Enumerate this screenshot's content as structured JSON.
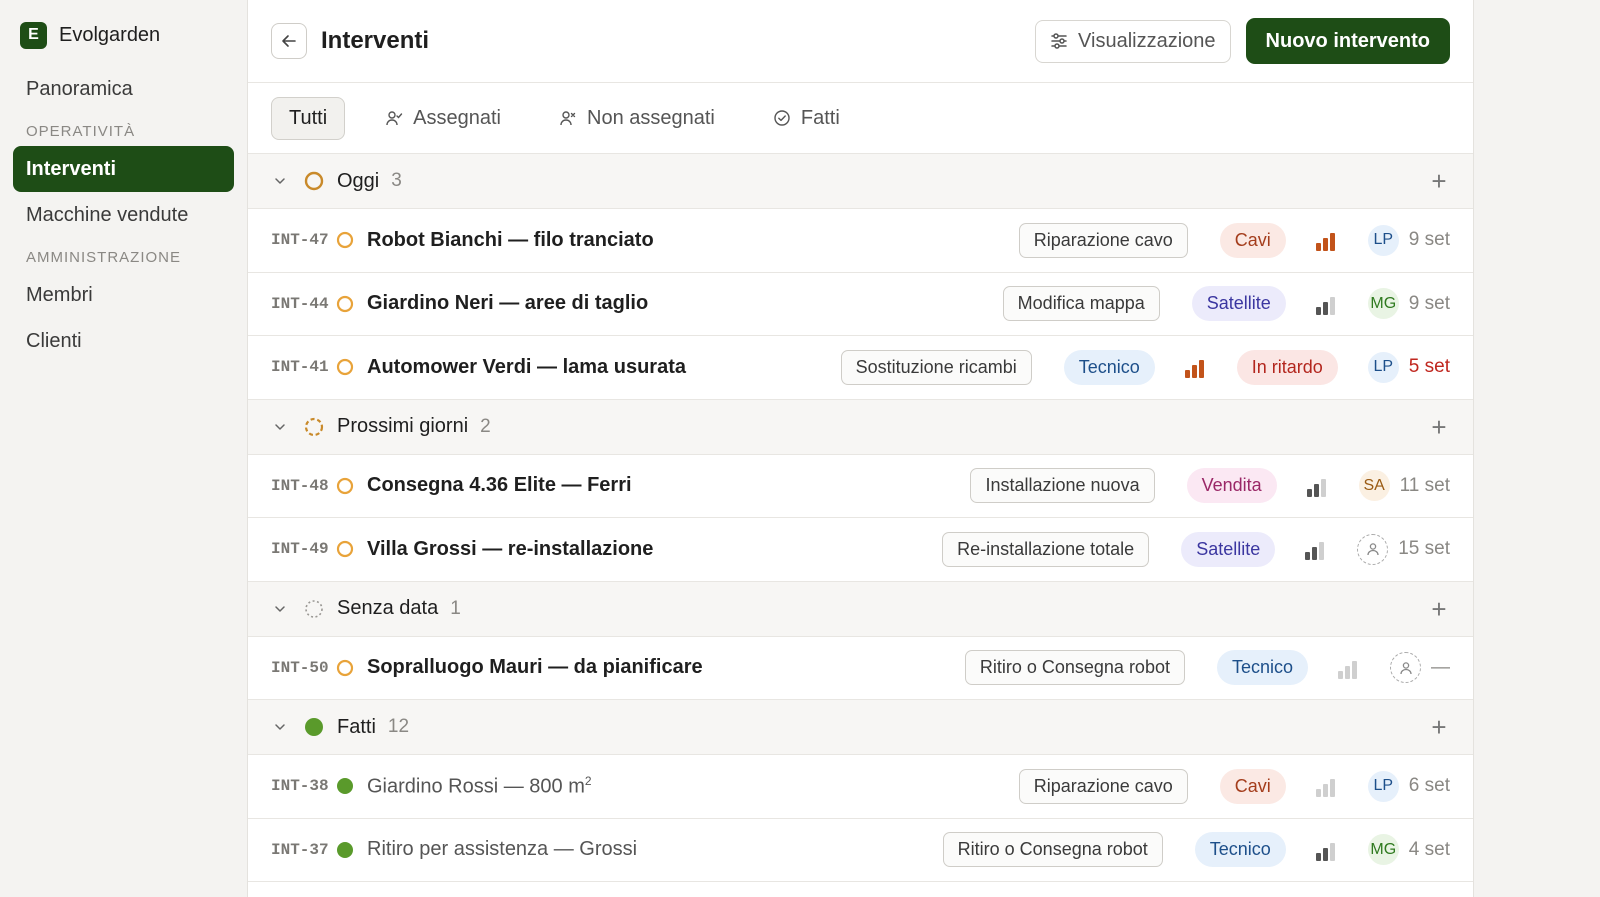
{
  "sidebar": {
    "brand_letter": "E",
    "brand_name": "Evolgarden",
    "overview": "Panoramica",
    "section_ops": "OPERATIVITÀ",
    "interventi": "Interventi",
    "machines": "Macchine vendute",
    "section_admin": "AMMINISTRAZIONE",
    "members": "Membri",
    "clients": "Clienti"
  },
  "header": {
    "title": "Interventi",
    "view_label": "Visualizzazione",
    "new_label": "Nuovo intervento"
  },
  "tabs": [
    "Tutti",
    "Assegnati",
    "Non assegnati",
    "Fatti"
  ],
  "groups": [
    {
      "title": "Oggi",
      "count": "3",
      "rows": [
        {
          "id": "INT-47",
          "title": "Robot Bianchi — filo tranciato",
          "type": "Riparazione cavo",
          "label": "Cavi",
          "priority": "high",
          "avatar": "LP",
          "date": "9 set"
        },
        {
          "id": "INT-44",
          "title": "Giardino Neri — aree di taglio",
          "type": "Modifica mappa",
          "label": "Satellite",
          "priority": "medium",
          "avatar": "MG",
          "date": "9 set"
        },
        {
          "id": "INT-41",
          "title": "Automower Verdi — lama usurata",
          "type": "Sostituzione ricambi",
          "label": "Tecnico",
          "priority": "high",
          "late_badge": "In ritardo",
          "avatar": "LP",
          "date": "5 set"
        }
      ]
    },
    {
      "title": "Prossimi giorni",
      "count": "2",
      "rows": [
        {
          "id": "INT-48",
          "title": "Consegna 4.36 Elite — Ferri",
          "type": "Installazione nuova",
          "label": "Vendita",
          "priority": "medium",
          "avatar": "SA",
          "date": "11 set"
        },
        {
          "id": "INT-49",
          "title": "Villa Grossi — re-installazione",
          "type": "Re-installazione totale",
          "label": "Satellite",
          "priority": "medium",
          "avatar": "",
          "date": "15 set"
        }
      ]
    },
    {
      "title": "Senza data",
      "count": "1",
      "rows": [
        {
          "id": "INT-50",
          "title": "Sopralluogo Mauri — da pianificare",
          "type": "Ritiro o Consegna robot",
          "label": "Tecnico",
          "priority": "low",
          "avatar": "",
          "date": "—"
        }
      ]
    },
    {
      "title": "Fatti",
      "count": "12",
      "rows": [
        {
          "id": "INT-38",
          "title": "Giardino Rossi — 800 m",
          "title_sup": "2",
          "type": "Riparazione cavo",
          "label": "Cavi",
          "priority": "low",
          "avatar": "LP",
          "date": "6 set"
        },
        {
          "id": "INT-37",
          "title": "Ritiro per assistenza — Grossi",
          "type": "Ritiro o Consegna robot",
          "label": "Tecnico",
          "priority": "medium",
          "avatar": "MG",
          "date": "4 set"
        }
      ]
    }
  ],
  "colors": {
    "brand": "#1e4d16",
    "late": "#c0271f",
    "pending": "#e8a33a",
    "done": "#5a9a2b"
  }
}
